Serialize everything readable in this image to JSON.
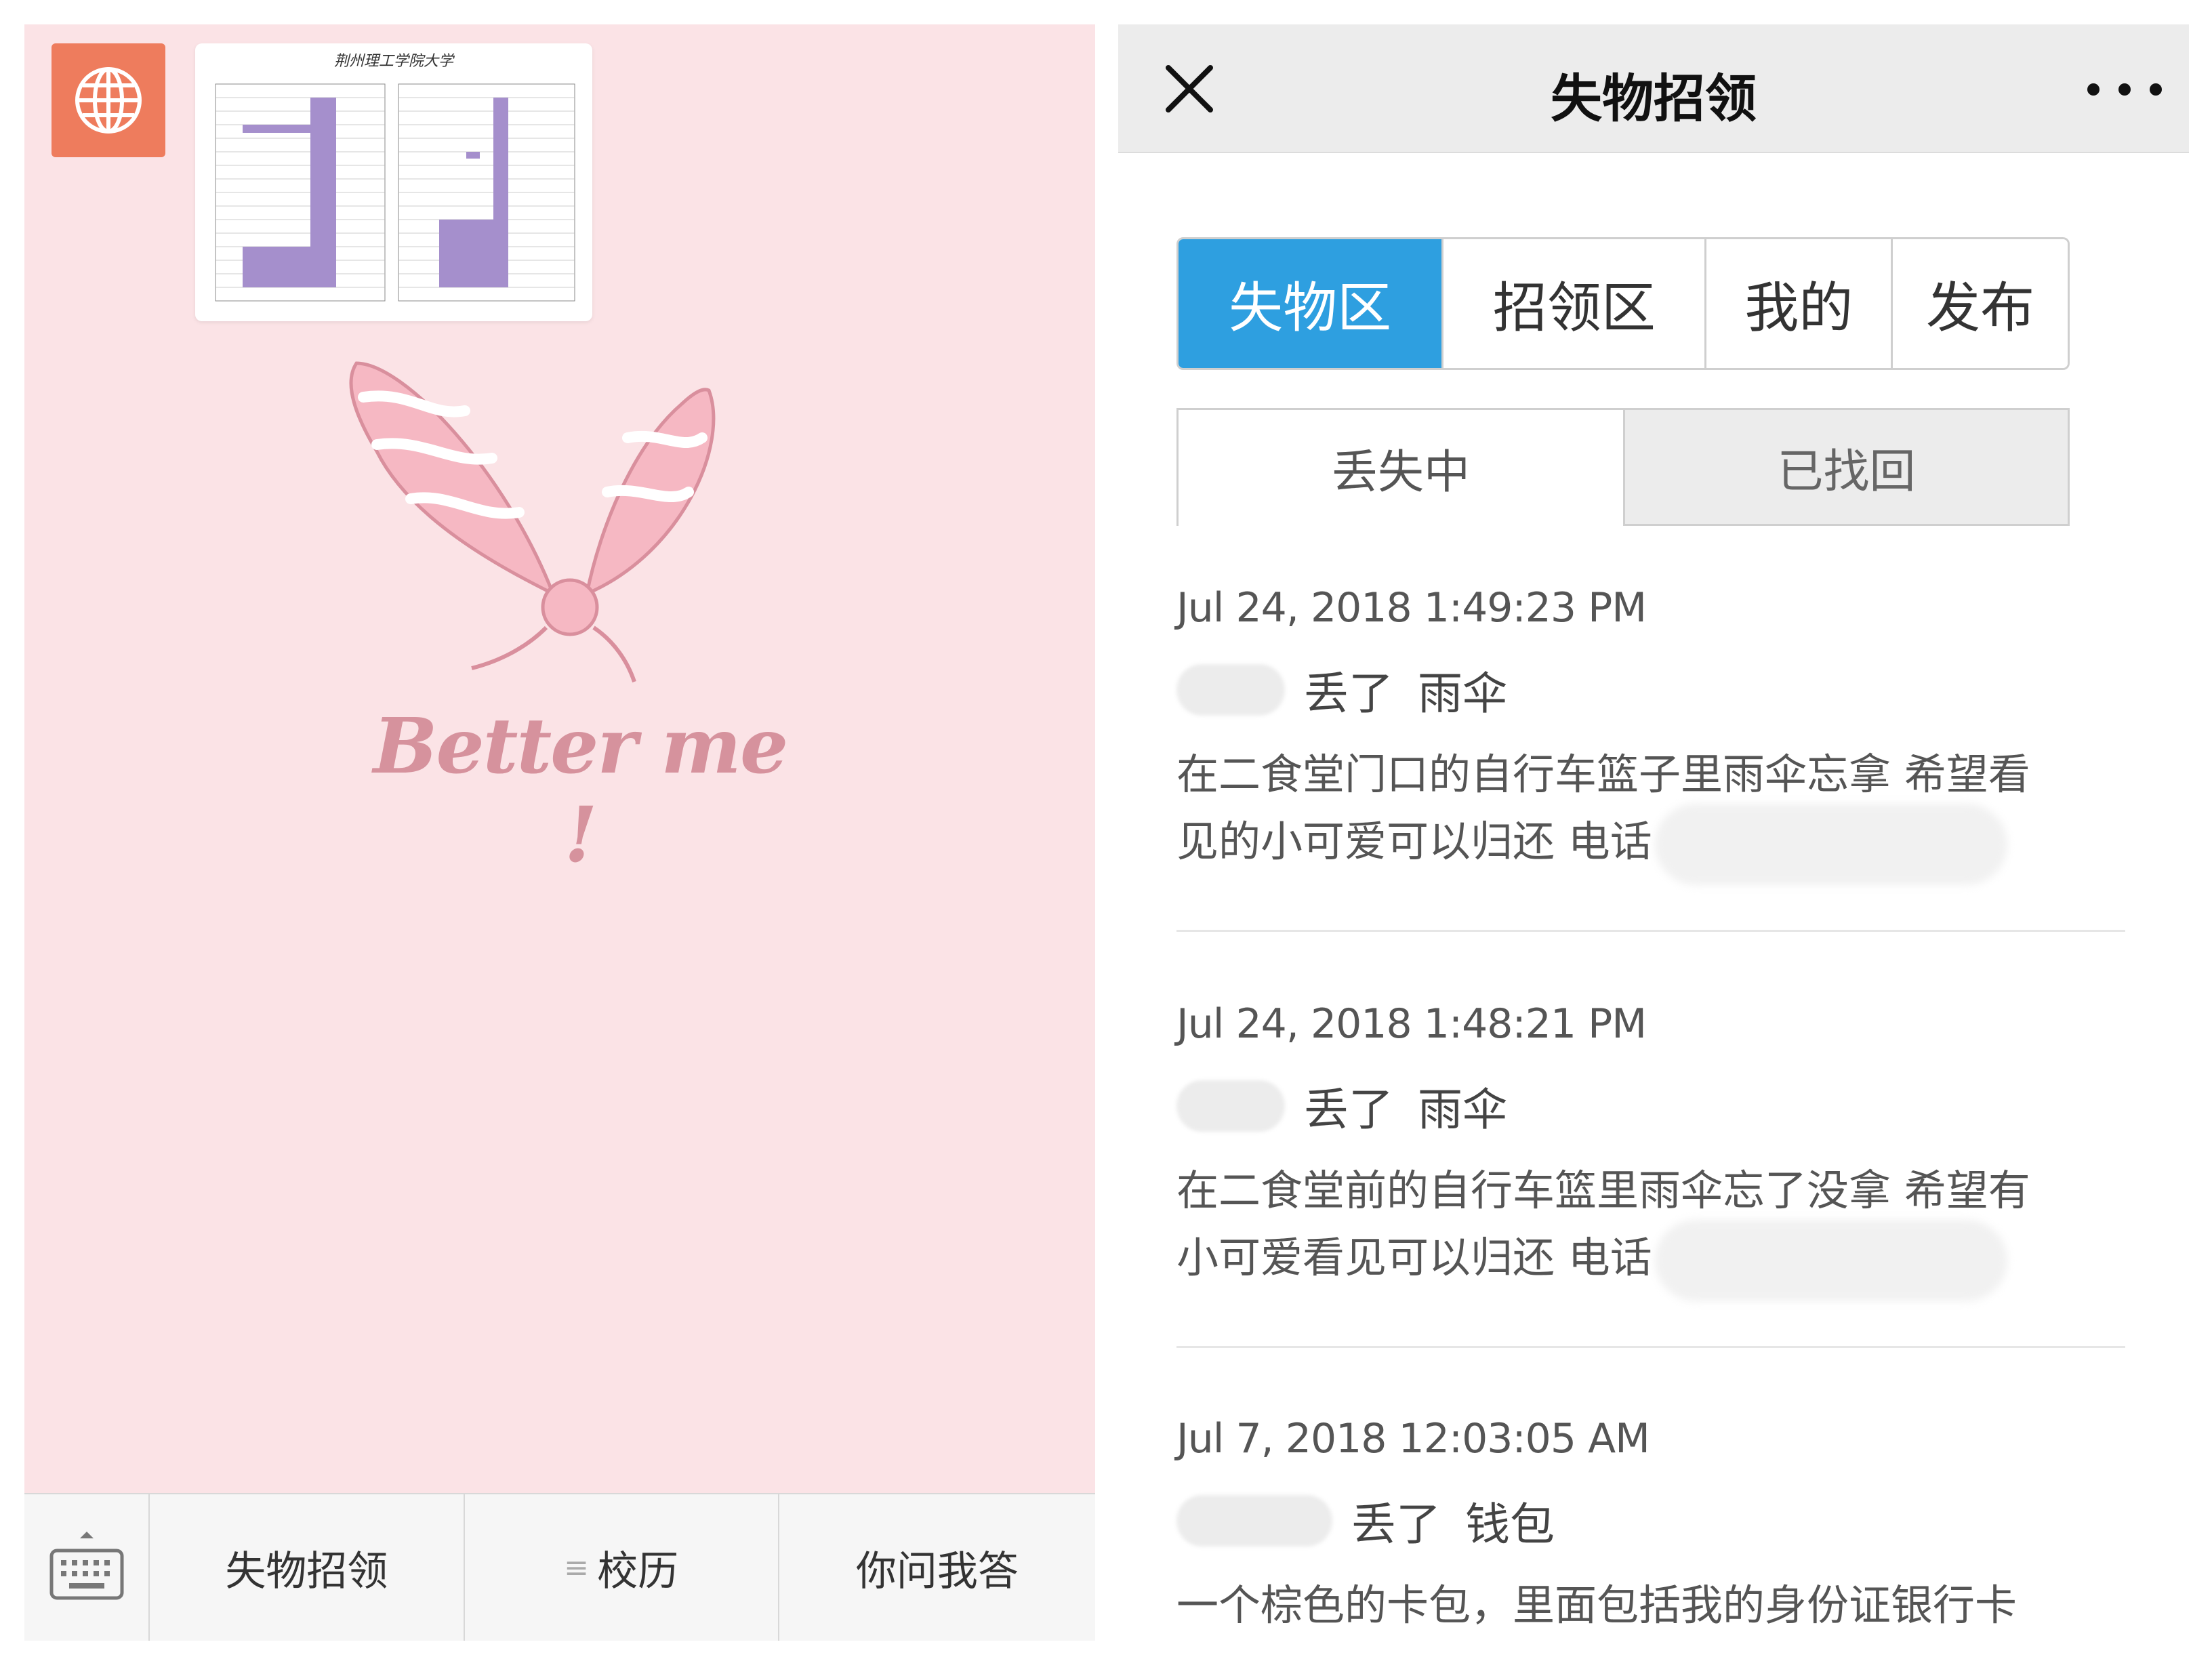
{
  "left_panel": {
    "thumbnail_title": "荆州理工学院大学",
    "slogan": "Better me !",
    "bottom_menu": {
      "items": [
        {
          "label": "失物招领",
          "prefix": ""
        },
        {
          "label": "校历",
          "prefix": "≡"
        },
        {
          "label": "你问我答",
          "prefix": ""
        }
      ]
    }
  },
  "right_panel": {
    "nav": {
      "title": "失物招领"
    },
    "main_tabs": [
      {
        "label": "失物区",
        "active": true
      },
      {
        "label": "招领区",
        "active": false
      },
      {
        "label": "我的",
        "active": false
      },
      {
        "label": "发布",
        "active": false
      }
    ],
    "sub_tabs": [
      {
        "label": "丢失中",
        "active": true
      },
      {
        "label": "已找回",
        "active": false
      }
    ],
    "posts": [
      {
        "date": "Jul 24, 2018 1:49:23 PM",
        "verb": "丢了",
        "item": "雨伞",
        "line1": "在二食堂门口的自行车篮子里雨伞忘拿 希望看",
        "line2": "见的小可爱可以归还 电话"
      },
      {
        "date": "Jul 24, 2018 1:48:21 PM",
        "verb": "丢了",
        "item": "雨伞",
        "line1": "在二食堂前的自行车篮里雨伞忘了没拿 希望有",
        "line2": "小可爱看见可以归还 电话"
      },
      {
        "date": "Jul 7, 2018 12:03:05 AM",
        "verb": "丢了",
        "item": "钱包",
        "line1": "一个棕色的卡包，里面包括我的身份证银行卡",
        "line2": ""
      }
    ]
  },
  "colors": {
    "left_bg": "#fbe3e6",
    "globe_bg": "#ee7c5d",
    "tab_active": "#2e9fe0",
    "slogan": "#d6929d"
  }
}
